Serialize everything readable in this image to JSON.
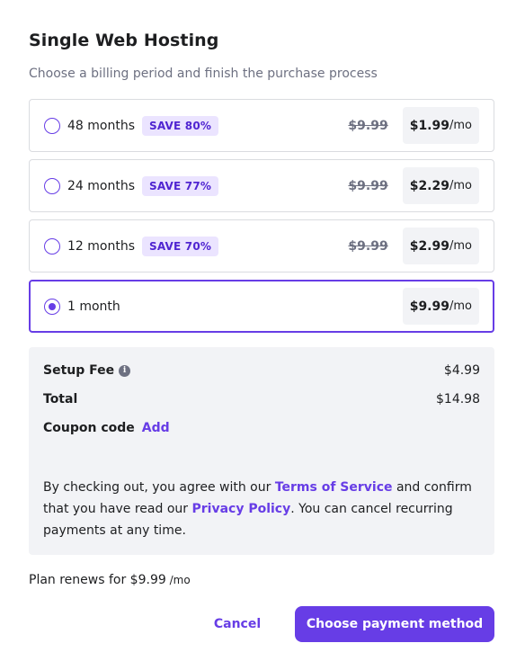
{
  "header": {
    "title": "Single Web Hosting",
    "subtitle": "Choose a billing period and finish the purchase process"
  },
  "plans": [
    {
      "label": "48 months",
      "badge": "SAVE 80%",
      "old_price": "$9.99",
      "price": "$1.99",
      "per": "/mo",
      "selected": false
    },
    {
      "label": "24 months",
      "badge": "SAVE 77%",
      "old_price": "$9.99",
      "price": "$2.29",
      "per": "/mo",
      "selected": false
    },
    {
      "label": "12 months",
      "badge": "SAVE 70%",
      "old_price": "$9.99",
      "price": "$2.99",
      "per": "/mo",
      "selected": false
    },
    {
      "label": "1 month",
      "price": "$9.99",
      "per": "/mo",
      "selected": true
    }
  ],
  "summary": {
    "setup_fee_label": "Setup Fee",
    "setup_fee_value": "$4.99",
    "info_icon": "i",
    "total_label": "Total",
    "total_value": "$14.98",
    "coupon_label": "Coupon code",
    "coupon_add": "Add",
    "terms_part1": "By checking out, you agree with our ",
    "terms_link": "Terms of Service",
    "terms_part2": " and confirm that you have read our ",
    "privacy_link": "Privacy Policy",
    "terms_part3": ". You can cancel recurring payments at any time."
  },
  "renewal": {
    "text": "Plan renews for $9.99",
    "per": " /mo"
  },
  "actions": {
    "cancel": "Cancel",
    "primary": "Choose payment method"
  },
  "colors": {
    "accent": "#673de6",
    "badge_bg": "#ebe4ff",
    "summary_bg": "#f2f3f6"
  }
}
